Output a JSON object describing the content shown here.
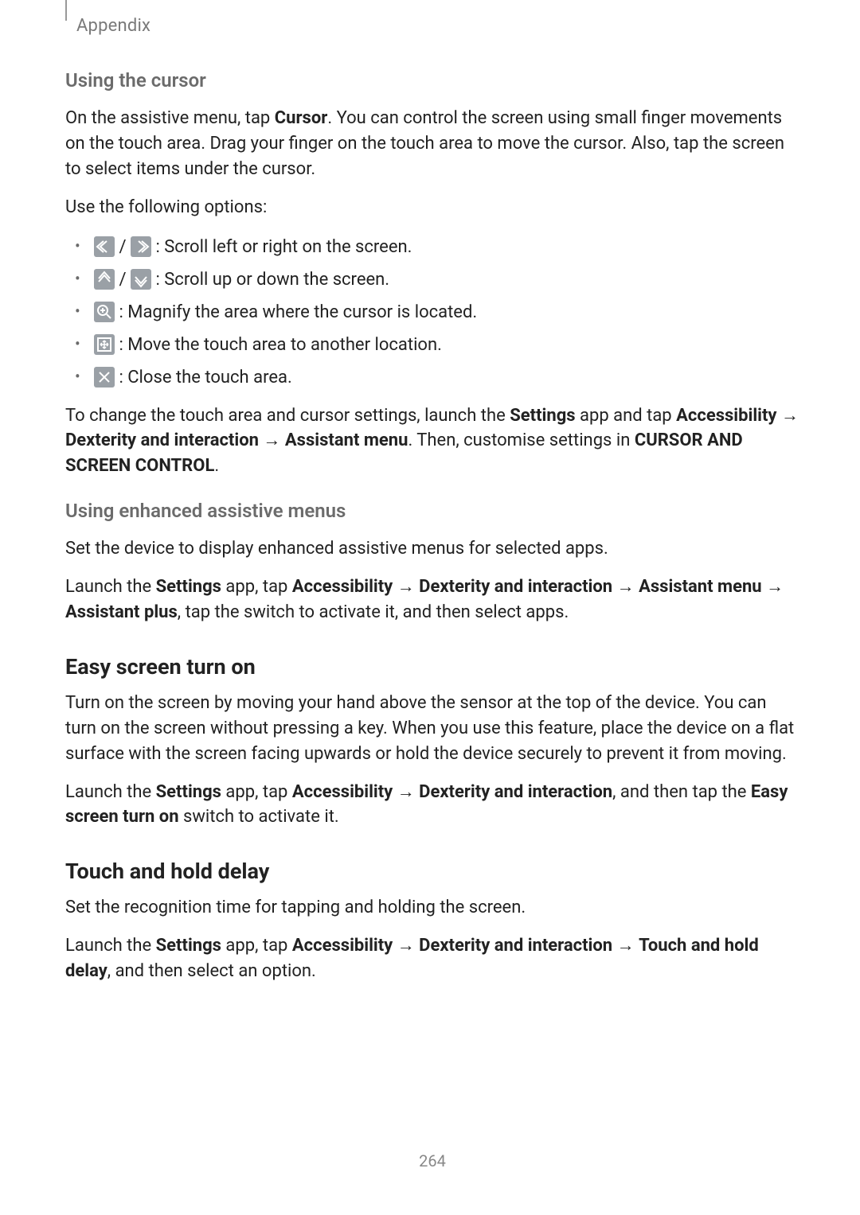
{
  "header": {
    "label": "Appendix"
  },
  "cursor_section": {
    "heading": "Using the cursor",
    "para1_pre": "On the assistive menu, tap ",
    "para1_bold": "Cursor",
    "para1_post": ". You can control the screen using small finger movements on the touch area. Drag your finger on the touch area to move the cursor. Also, tap the screen to select items under the cursor.",
    "para2": "Use the following options:",
    "bullets": {
      "b1": " : Scroll left or right on the screen.",
      "b2": " : Scroll up or down the screen.",
      "b3": " : Magnify the area where the cursor is located.",
      "b4": " : Move the touch area to another location.",
      "b5": " : Close the touch area."
    },
    "para3_pre": "To change the touch area and cursor settings, launch the ",
    "para3_b1": "Settings",
    "para3_mid1": " app and tap ",
    "para3_b2": "Accessibility",
    "para3_arrow1": " → ",
    "para3_b3": "Dexterity and interaction",
    "para3_arrow2": " → ",
    "para3_b4": "Assistant menu",
    "para3_mid2": ". Then, customise settings in ",
    "para3_b5": "CURSOR AND SCREEN CONTROL",
    "para3_end": "."
  },
  "enhanced_section": {
    "heading": "Using enhanced assistive menus",
    "para1": "Set the device to display enhanced assistive menus for selected apps.",
    "para2_pre": "Launch the ",
    "para2_b1": "Settings",
    "para2_mid1": " app, tap ",
    "para2_b2": "Accessibility",
    "para2_arrow1": " → ",
    "para2_b3": "Dexterity and interaction",
    "para2_arrow2": " → ",
    "para2_b4": "Assistant menu",
    "para2_arrow3": " → ",
    "para2_b5": "Assistant plus",
    "para2_post": ", tap the switch to activate it, and then select apps."
  },
  "easy_section": {
    "heading": "Easy screen turn on",
    "para1": "Turn on the screen by moving your hand above the sensor at the top of the device. You can turn on the screen without pressing a key. When you use this feature, place the device on a flat surface with the screen facing upwards or hold the device securely to prevent it from moving.",
    "para2_pre": "Launch the ",
    "para2_b1": "Settings",
    "para2_mid1": " app, tap ",
    "para2_b2": "Accessibility",
    "para2_arrow1": " → ",
    "para2_b3": "Dexterity and interaction",
    "para2_mid2": ", and then tap the ",
    "para2_b4": "Easy screen turn on",
    "para2_post": " switch to activate it."
  },
  "touch_section": {
    "heading": "Touch and hold delay",
    "para1": "Set the recognition time for tapping and holding the screen.",
    "para2_pre": "Launch the ",
    "para2_b1": "Settings",
    "para2_mid1": " app, tap ",
    "para2_b2": "Accessibility",
    "para2_arrow1": " → ",
    "para2_b3": "Dexterity and interaction",
    "para2_arrow2": " → ",
    "para2_b4": "Touch and hold delay",
    "para2_post": ", and then select an option."
  },
  "page_number": "264",
  "separator": " / "
}
